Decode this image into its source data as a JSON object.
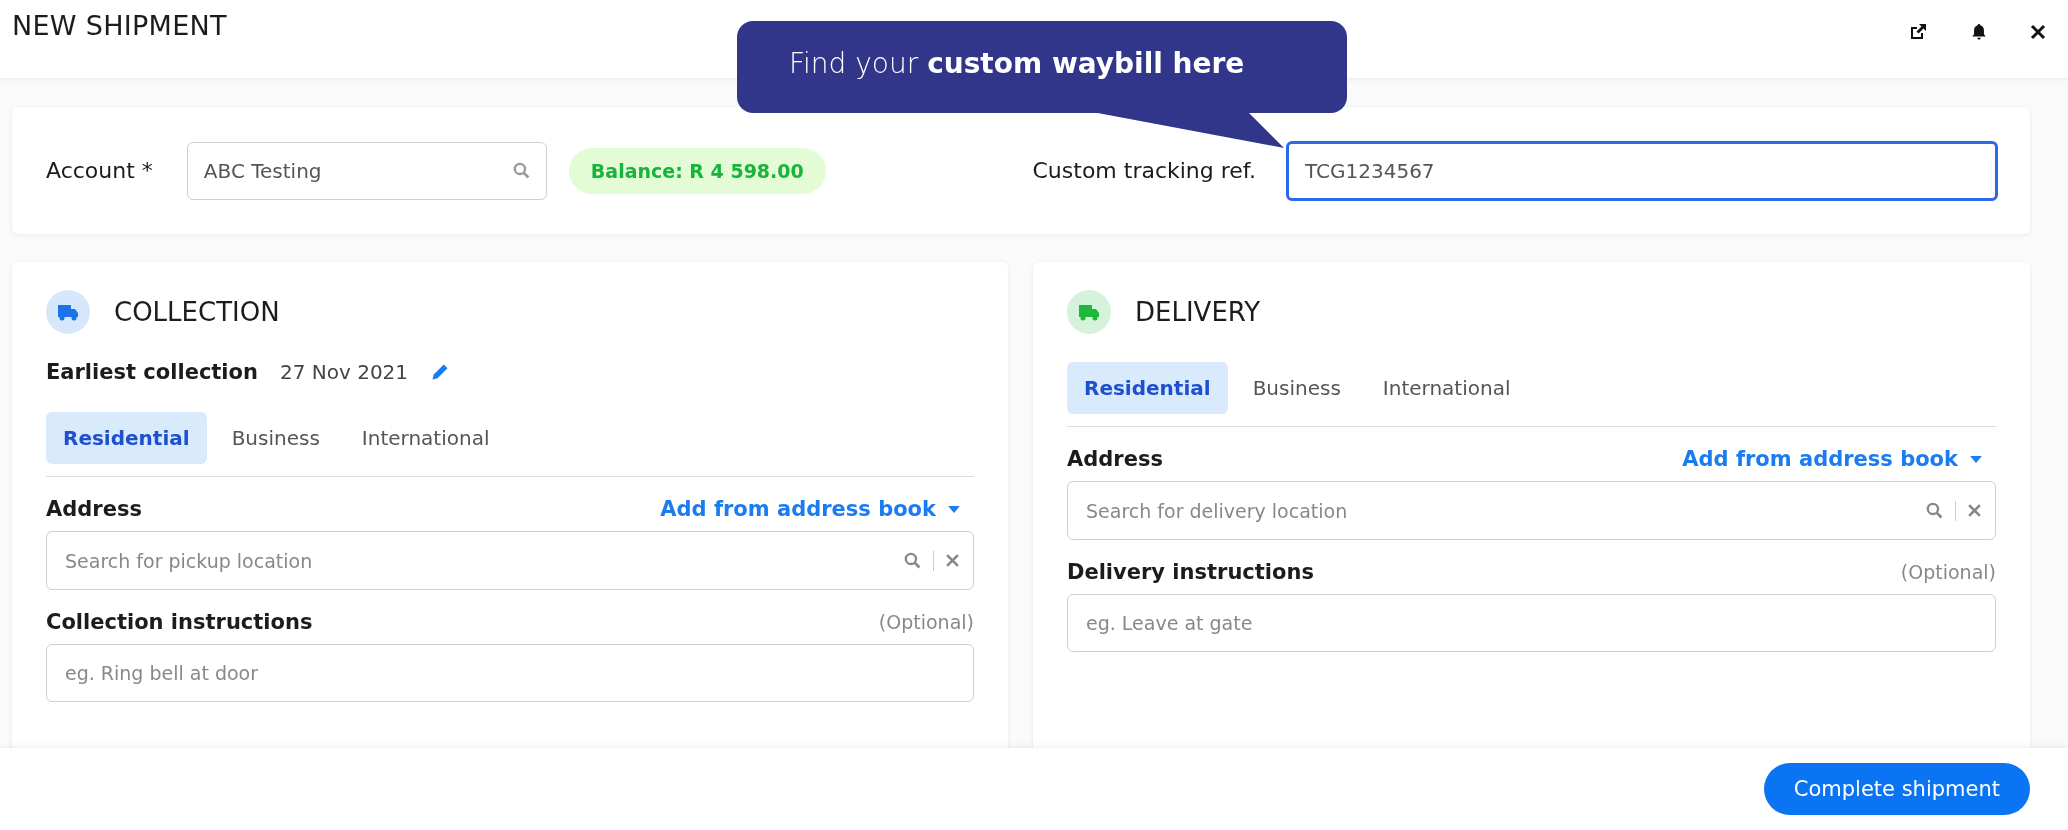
{
  "header": {
    "title": "NEW SHIPMENT"
  },
  "tooltip": {
    "text": "Find your **custom waybill here**"
  },
  "account": {
    "label": "Account *",
    "value": "ABC Testing",
    "balance": "Balance: R 4 598.00",
    "tracking_label": "Custom tracking ref.",
    "tracking_value": "TCG1234567"
  },
  "sections": [
    {
      "kind": "collection",
      "title": "COLLECTION",
      "color": "#1a73e8",
      "earliest": {
        "label": "Earliest collection",
        "value": "27 Nov 2021"
      },
      "tabs": [
        {
          "label": "Residential",
          "selected": true
        },
        {
          "label": "Business",
          "selected": false
        },
        {
          "label": "International",
          "selected": false
        }
      ],
      "address_label": "Address",
      "address_link": "Add from address book",
      "address_placeholder": "Search for pickup location",
      "instructions_label": "Collection instructions",
      "optional": "(Optional)",
      "instructions_placeholder": "eg. Ring bell at door"
    },
    {
      "kind": "delivery",
      "title": "DELIVERY",
      "color": "#1db93a",
      "tabs": [
        {
          "label": "Residential",
          "selected": true
        },
        {
          "label": "Business",
          "selected": false
        },
        {
          "label": "International",
          "selected": false
        }
      ],
      "address_label": "Address",
      "address_link": "Add from address book",
      "address_placeholder": "Search for delivery location",
      "instructions_label": "Delivery instructions",
      "optional": "(Optional)",
      "instructions_placeholder": "eg. Leave at gate"
    }
  ],
  "footer": {
    "button": "Complete shipment"
  }
}
